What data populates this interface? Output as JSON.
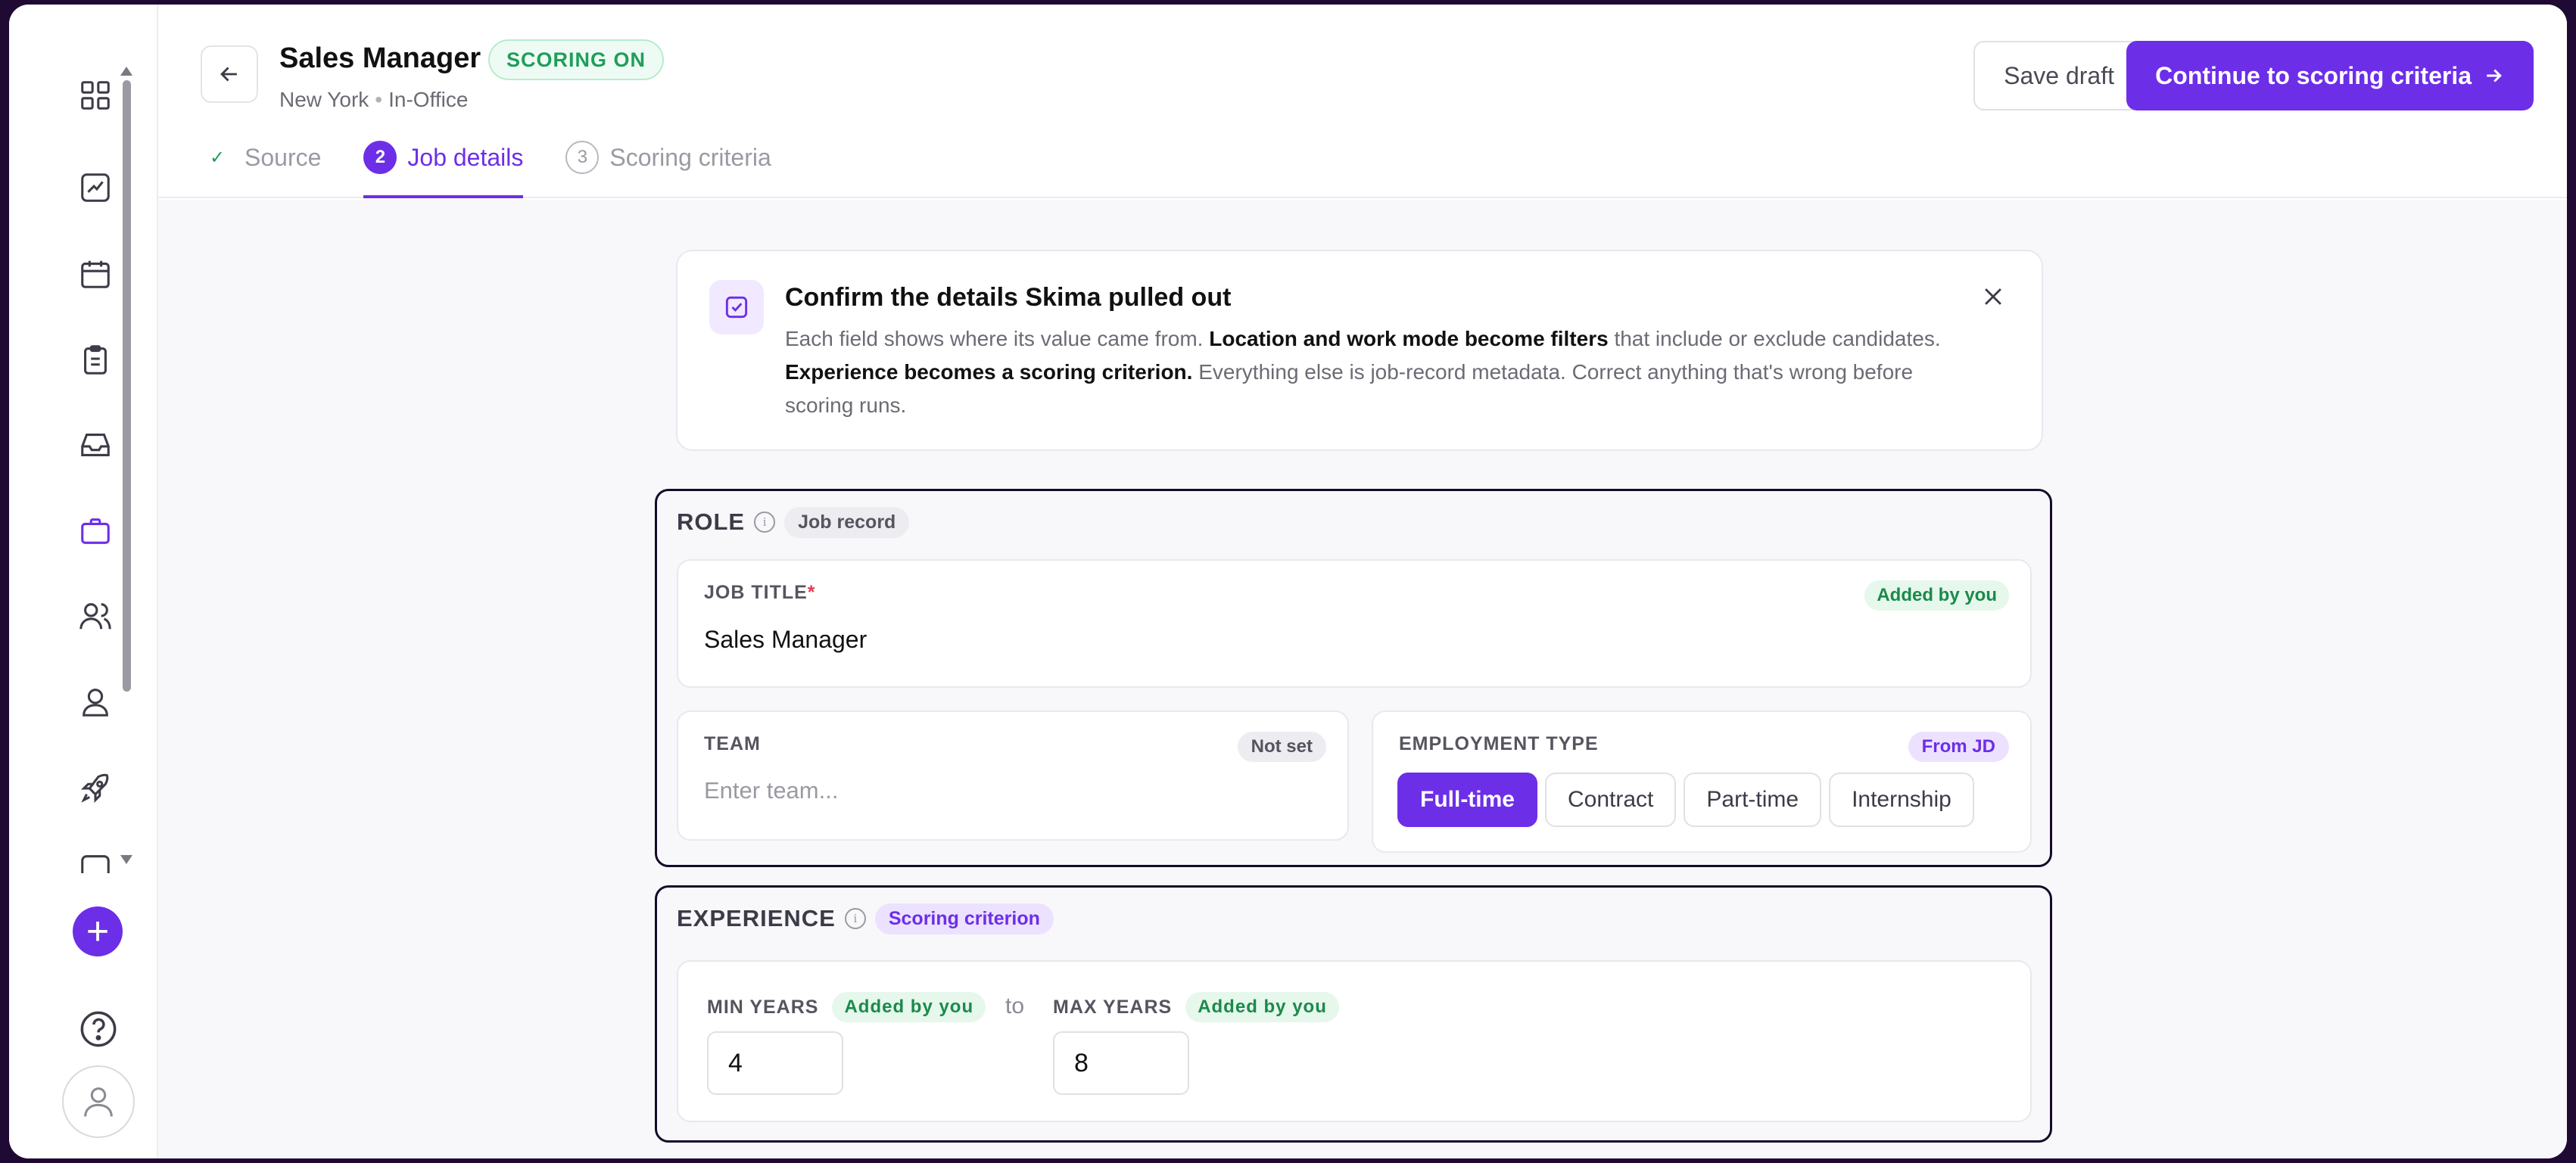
{
  "header": {
    "title": "Sales Manager",
    "status_badge": "SCORING ON",
    "location": "New York",
    "work_mode": "In-Office",
    "save_draft_label": "Save draft",
    "continue_label": "Continue to scoring criteria"
  },
  "steps": [
    {
      "num": "✓",
      "label": "Source",
      "state": "done"
    },
    {
      "num": "2",
      "label": "Job details",
      "state": "active"
    },
    {
      "num": "3",
      "label": "Scoring criteria",
      "state": "future"
    }
  ],
  "sidebar": {
    "icons": [
      "grid-icon",
      "chart-icon",
      "calendar-icon",
      "clipboard-icon",
      "inbox-icon",
      "briefcase-icon",
      "users-icon",
      "person-icon",
      "rocket-icon",
      "folder-icon"
    ],
    "active": "briefcase-icon"
  },
  "info": {
    "title": "Confirm the details Skima pulled out",
    "body_1": "Each field shows where its value came from. ",
    "body_bold_1": "Location and work mode become filters",
    "body_2": " that include or exclude candidates. ",
    "body_bold_2": "Experience becomes a scoring criterion.",
    "body_3": " Everything else is job-record metadata. Correct anything that's wrong before scoring runs."
  },
  "role": {
    "label": "ROLE",
    "tag": "Job record",
    "job_title": {
      "label": "JOB TITLE",
      "required": "*",
      "value": "Sales Manager",
      "source": "Added by you"
    },
    "team": {
      "label": "TEAM",
      "placeholder": "Enter team...",
      "source": "Not set"
    },
    "employment_type": {
      "label": "EMPLOYMENT TYPE",
      "source": "From JD",
      "options": [
        "Full-time",
        "Contract",
        "Part-time",
        "Internship"
      ],
      "selected": "Full-time"
    }
  },
  "experience": {
    "label": "EXPERIENCE",
    "tag": "Scoring criterion",
    "min": {
      "label": "MIN YEARS",
      "source": "Added by you",
      "value": "4"
    },
    "to": "to",
    "max": {
      "label": "MAX YEARS",
      "source": "Added by you",
      "value": "8"
    }
  },
  "colors": {
    "accent": "#6d2ee8",
    "success": "#1f9e5a"
  }
}
